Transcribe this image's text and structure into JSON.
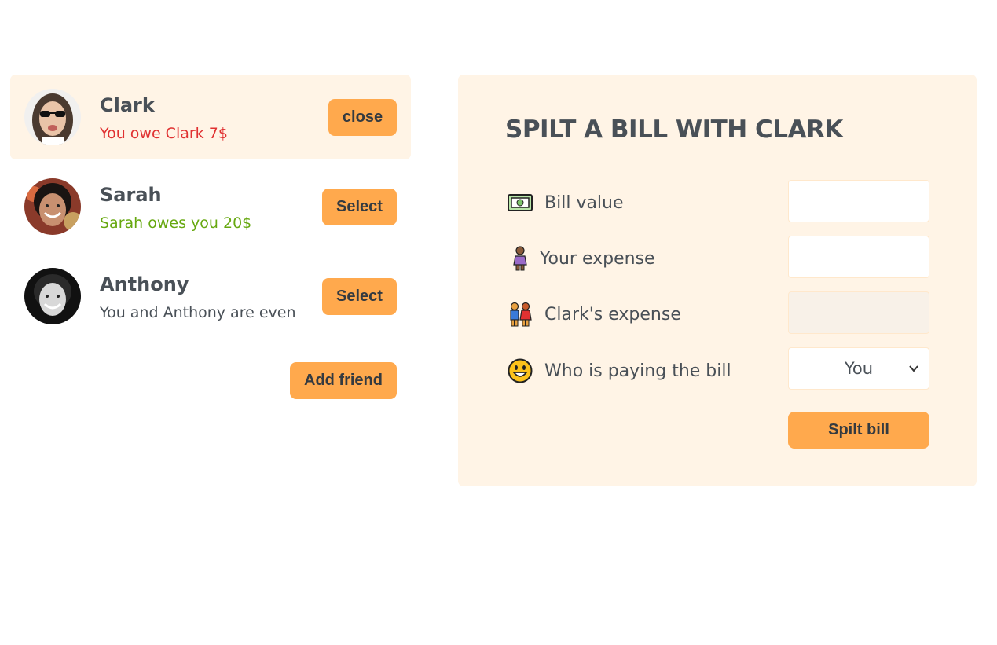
{
  "friends": [
    {
      "name": "Clark",
      "status": "You owe Clark 7$",
      "status_type": "owe",
      "button": "close",
      "selected": true
    },
    {
      "name": "Sarah",
      "status": "Sarah owes you 20$",
      "status_type": "owed",
      "button": "Select",
      "selected": false
    },
    {
      "name": "Anthony",
      "status": "You and Anthony are even",
      "status_type": "even",
      "button": "Select",
      "selected": false
    }
  ],
  "add_friend_label": "Add friend",
  "form": {
    "title": "SPILT A BILL WITH CLARK",
    "bill_label": "Bill value",
    "bill_value": "",
    "your_expense_label": "Your expense",
    "your_expense_value": "",
    "friend_expense_label": "Clark's expense",
    "friend_expense_value": "",
    "payer_label": "Who is paying the bill",
    "payer_selected": "You",
    "submit_label": "Spilt bill"
  },
  "colors": {
    "accent": "#ffa94d",
    "panel": "#fff4e6",
    "owe": "#e03131",
    "owed": "#66a80f",
    "text": "#495057"
  }
}
